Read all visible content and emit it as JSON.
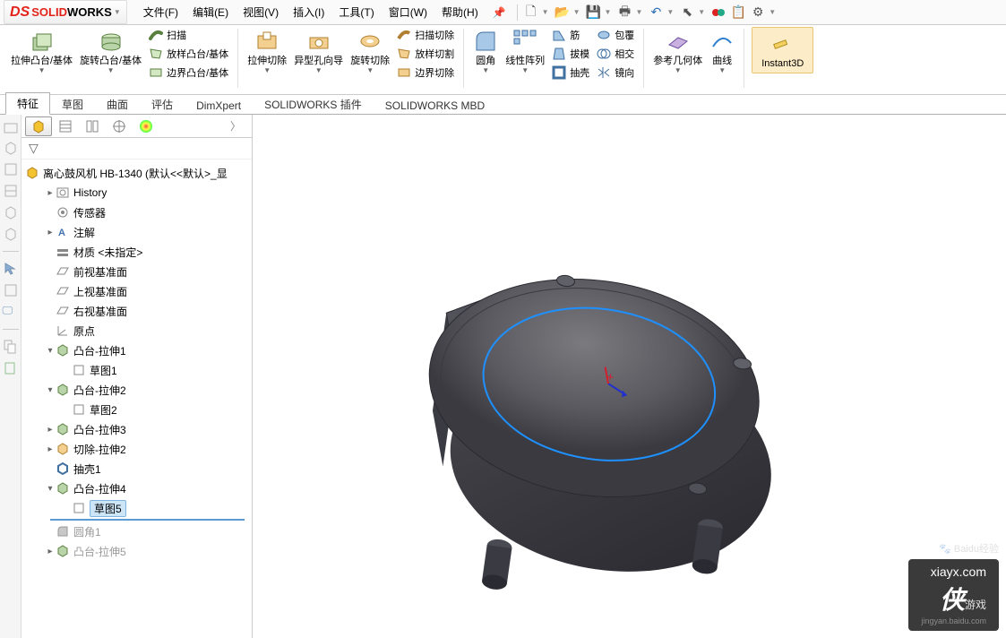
{
  "logo": {
    "brand": "SOLID",
    "brand2": "WORKS"
  },
  "menu": [
    "文件(F)",
    "编辑(E)",
    "视图(V)",
    "插入(I)",
    "工具(T)",
    "窗口(W)",
    "帮助(H)"
  ],
  "ribbon": {
    "g1": {
      "boss": "拉伸凸台/基体",
      "rev": "旋转凸台/基体",
      "sweep": "扫描",
      "loft": "放样凸台/基体",
      "boundary": "边界凸台/基体"
    },
    "g2": {
      "cut": "拉伸切除",
      "hole": "异型孔向导",
      "revcut": "旋转切除",
      "swcut": "扫描切除",
      "loftcut": "放样切割",
      "bndcut": "边界切除"
    },
    "g3": {
      "fillet": "圆角",
      "pattern": "线性阵列",
      "rib": "筋",
      "draft": "拔模",
      "shell": "抽壳",
      "wrap": "包覆",
      "intersect": "相交",
      "mirror": "镜向"
    },
    "g4": {
      "refgeo": "参考几何体",
      "curve": "曲线"
    },
    "g5": {
      "instant3d": "Instant3D"
    }
  },
  "tabs": [
    "特征",
    "草图",
    "曲面",
    "评估",
    "DimXpert",
    "SOLIDWORKS 插件",
    "SOLIDWORKS MBD"
  ],
  "active_tab": 0,
  "tree": {
    "root": "离心鼓风机 HB-1340  (默认<<默认>_显",
    "items": [
      {
        "ic": "hist",
        "lbl": "History",
        "tw": "▸",
        "indent": 1
      },
      {
        "ic": "sensor",
        "lbl": "传感器",
        "indent": 1
      },
      {
        "ic": "annot",
        "lbl": "注解",
        "tw": "▸",
        "indent": 1
      },
      {
        "ic": "mat",
        "lbl": "材质 <未指定>",
        "indent": 1
      },
      {
        "ic": "plane",
        "lbl": "前视基准面",
        "indent": 1
      },
      {
        "ic": "plane",
        "lbl": "上视基准面",
        "indent": 1
      },
      {
        "ic": "plane",
        "lbl": "右视基准面",
        "indent": 1
      },
      {
        "ic": "origin",
        "lbl": "原点",
        "indent": 1
      },
      {
        "ic": "feat",
        "lbl": "凸台-拉伸1",
        "tw": "▾",
        "indent": 1
      },
      {
        "ic": "sketch",
        "lbl": "草图1",
        "indent": 2
      },
      {
        "ic": "feat",
        "lbl": "凸台-拉伸2",
        "tw": "▾",
        "indent": 1
      },
      {
        "ic": "sketch",
        "lbl": "草图2",
        "indent": 2
      },
      {
        "ic": "feat",
        "lbl": "凸台-拉伸3",
        "tw": "▸",
        "indent": 1
      },
      {
        "ic": "cut",
        "lbl": "切除-拉伸2",
        "tw": "▸",
        "indent": 1
      },
      {
        "ic": "shell",
        "lbl": "抽壳1",
        "indent": 1
      },
      {
        "ic": "feat",
        "lbl": "凸台-拉伸4",
        "tw": "▾",
        "indent": 1
      },
      {
        "ic": "sketch",
        "lbl": "草图5",
        "indent": 2,
        "sel": true
      },
      {
        "ic": "fillet",
        "lbl": "圆角1",
        "indent": 1,
        "gray": true
      },
      {
        "ic": "feat",
        "lbl": "凸台-拉伸5",
        "tw": "▸",
        "indent": 1,
        "gray": true
      }
    ]
  },
  "watermark": {
    "url": "xiayx.com",
    "main": "侠",
    "sub": "游戏",
    "faint": "jingyan.baidu.com"
  }
}
